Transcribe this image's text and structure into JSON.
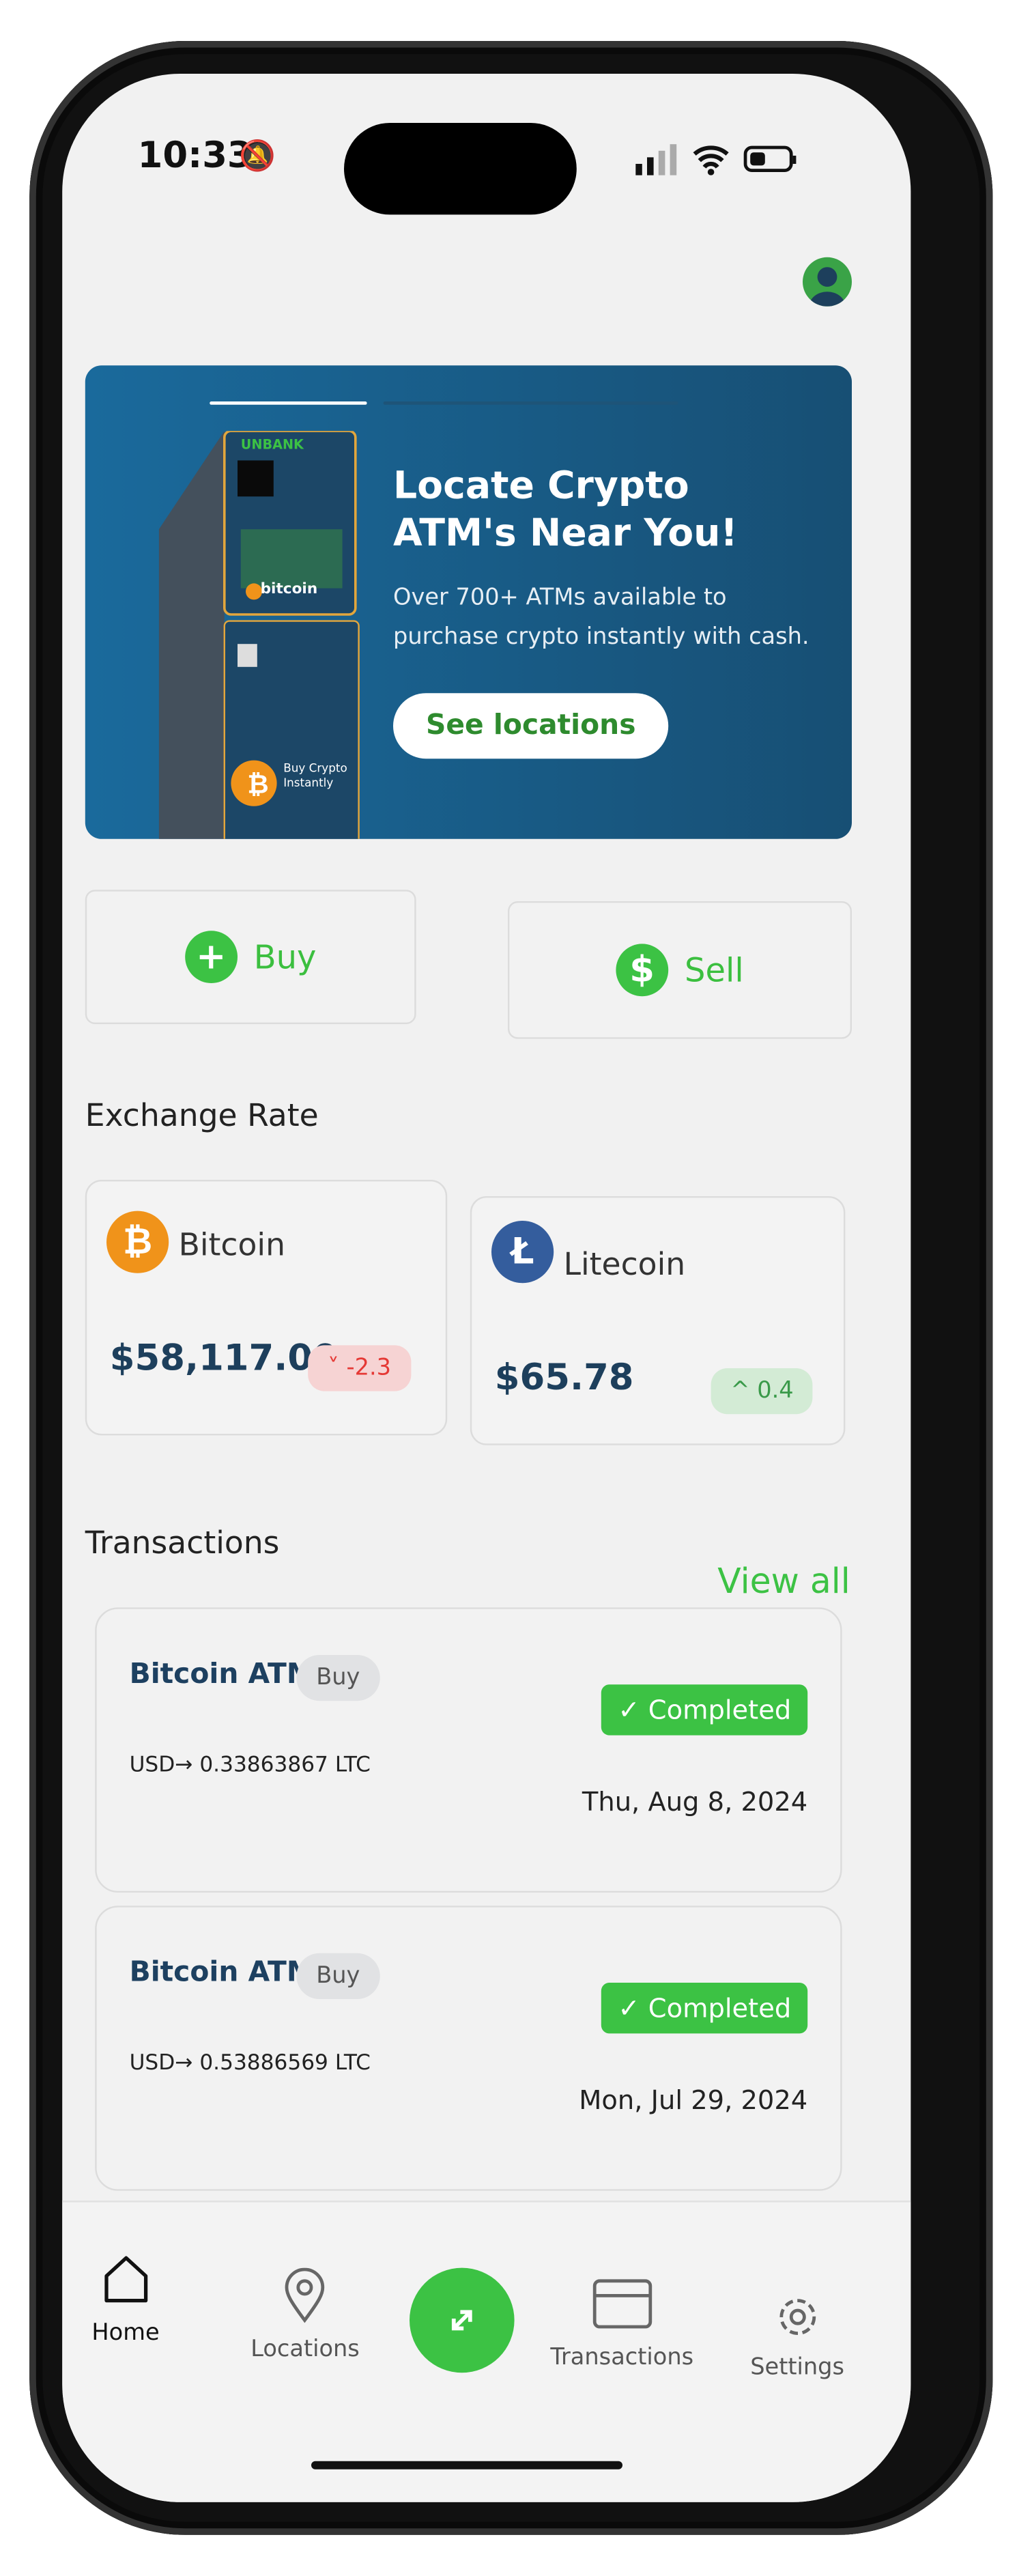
{
  "status_bar": {
    "time": "10:33"
  },
  "banner": {
    "title_line1": "Locate Crypto",
    "title_line2": "ATM's Near You!",
    "subtitle_line1": "Over 700+ ATMs available to",
    "subtitle_line2": "purchase crypto instantly with cash.",
    "button_label": "See locations",
    "atm_logo": "UNBANK",
    "atm_brand": "bitcoin",
    "atm_cta": "Buy Crypto Instantly"
  },
  "actions": {
    "buy_label": "Buy",
    "sell_label": "Sell"
  },
  "exchange": {
    "heading": "Exchange Rate",
    "coins": [
      {
        "name": "Bitcoin",
        "price": "$58,117.00",
        "change": "-2.3",
        "direction": "down",
        "color": "#f0931a"
      },
      {
        "name": "Litecoin",
        "price": "$65.78",
        "change": "0.4",
        "direction": "up",
        "color": "#345d9d"
      }
    ]
  },
  "transactions": {
    "heading": "Transactions",
    "view_all": "View all",
    "items": [
      {
        "title": "Bitcoin ATM",
        "type": "Buy",
        "amount": "USD→ 0.33863867 LTC",
        "status": "Completed",
        "date": "Thu, Aug 8, 2024"
      },
      {
        "title": "Bitcoin ATM",
        "type": "Buy",
        "amount": "USD→ 0.53886569 LTC",
        "status": "Completed",
        "date": "Mon, Jul 29, 2024"
      }
    ]
  },
  "nav": {
    "home": "Home",
    "locations": "Locations",
    "transactions": "Transactions",
    "settings": "Settings"
  },
  "colors": {
    "accent": "#3cc244",
    "navy": "#1d4060",
    "banner": "#1a6a9c",
    "negative": "#e53935",
    "positive": "#3a9a4a"
  }
}
